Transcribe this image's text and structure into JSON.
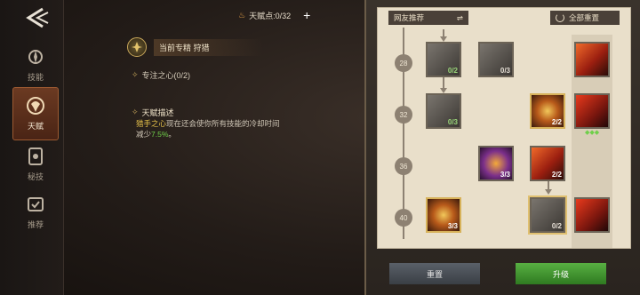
{
  "nav": {
    "items": [
      {
        "label": "技能",
        "icon": "skill-icon"
      },
      {
        "label": "天赋",
        "icon": "talent-icon",
        "active": true
      },
      {
        "label": "秘技",
        "icon": "secret-icon"
      },
      {
        "label": "推荐",
        "icon": "recommend-icon"
      }
    ]
  },
  "header": {
    "talent_points": "天赋点:0/32",
    "add_symbol": "+"
  },
  "spec": {
    "label": "当前专精 狩猎"
  },
  "focus": {
    "label": "专注之心(0/2)"
  },
  "description": {
    "title": "天赋描述",
    "hl_name": "猎手之心",
    "text_a": "现在还会使你所有技能的冷却时间",
    "text_b": "减少",
    "hl_value": "7.5%",
    "text_end": "。"
  },
  "panel": {
    "recommend_label": "网友推荐",
    "swap_symbol": "⇌",
    "reset_all_label": "全部重置",
    "levels": [
      "28",
      "32",
      "36",
      "40"
    ],
    "nodes": {
      "r1c1": "0/2",
      "r1c2": "0/3",
      "r2c1": "0/3",
      "r2c3": "2/2",
      "r3c2": "3/3",
      "r3c3": "2/2",
      "r4c1": "3/3",
      "r4c3": "0/2"
    },
    "side_gem": "◆◆◆"
  },
  "buttons": {
    "reset": "重置",
    "upgrade": "升级"
  },
  "colors": {
    "accent_green": "#58b042",
    "accent_gold": "#d7b25a",
    "highlight_yellow": "#e7c24a"
  }
}
